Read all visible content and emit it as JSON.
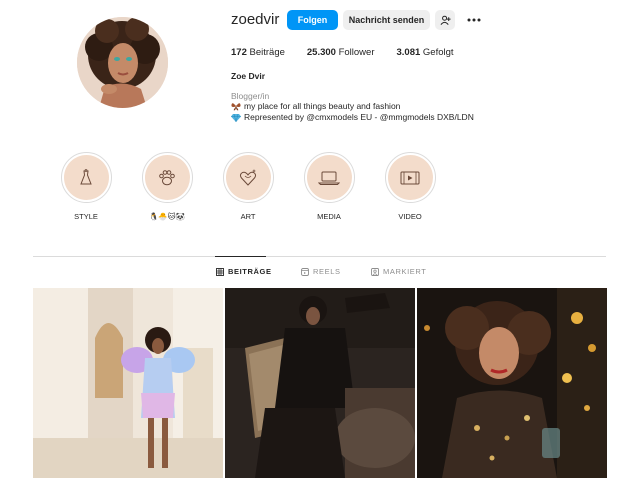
{
  "profile": {
    "username": "zoedvir",
    "follow_label": "Folgen",
    "message_label": "Nachricht senden",
    "add_user_icon": "person-add-icon",
    "more_icon": "more-dots-icon",
    "stats": {
      "posts_count": "172",
      "posts_label": "Beiträge",
      "followers_count": "25.300",
      "followers_label": "Follower",
      "following_count": "3.081",
      "following_label": "Gefolgt"
    },
    "full_name": "Zoe Dvir",
    "category": "Blogger/in",
    "bio_line1": "my place for all things beauty and fashion",
    "bio_line2": "Represented by @cmxmodels EU - @mmgmodels DXB/LDN"
  },
  "highlights": [
    {
      "label": "STYLE",
      "icon": "dress-icon"
    },
    {
      "label": "🐧🐣🐱🐼",
      "icon": "paw-icon"
    },
    {
      "label": "ART",
      "icon": "heart-sparkle-icon"
    },
    {
      "label": "MEDIA",
      "icon": "laptop-icon"
    },
    {
      "label": "VIDEO",
      "icon": "film-icon"
    }
  ],
  "tabs": [
    {
      "label": "BEITRÄGE",
      "icon": "grid-icon",
      "active": true
    },
    {
      "label": "REELS",
      "icon": "reels-icon",
      "active": false
    },
    {
      "label": "MARKIERT",
      "icon": "tag-icon",
      "active": false
    }
  ],
  "colors": {
    "accent": "#0095f6",
    "highlight_bg": "#f3dccb",
    "text": "#262626",
    "muted": "#8e8e8e"
  }
}
